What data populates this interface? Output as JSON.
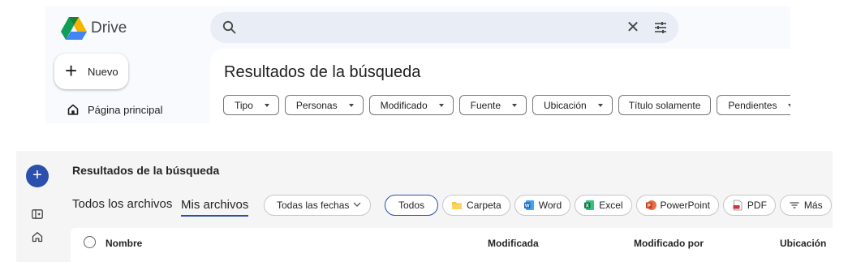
{
  "drive": {
    "app_name": "Drive",
    "search": {
      "placeholder": ""
    },
    "new_button": "Nuevo",
    "home_label": "Página principal",
    "results_title": "Resultados de la búsqueda",
    "filters": [
      {
        "label": "Tipo",
        "dropdown": true
      },
      {
        "label": "Personas",
        "dropdown": true
      },
      {
        "label": "Modificado",
        "dropdown": true
      },
      {
        "label": "Fuente",
        "dropdown": true
      },
      {
        "label": "Ubicación",
        "dropdown": true
      },
      {
        "label": "Título solamente",
        "dropdown": false
      },
      {
        "label": "Pendientes",
        "dropdown": true
      }
    ],
    "colors": {
      "logo_green": "#0f9d58",
      "logo_yellow": "#f4b400",
      "logo_blue": "#4285f4",
      "search_bg": "#e9eef6"
    }
  },
  "onedrive": {
    "fab_label": "+",
    "results_title": "Resultados de la búsqueda",
    "tabs": {
      "all": "Todos los archivos",
      "mine": "Mis archivos",
      "selected": "mine"
    },
    "date_filter": "Todas las fechas",
    "type_filters": [
      {
        "label": "Todos",
        "icon": "none",
        "active": true
      },
      {
        "label": "Carpeta",
        "icon": "folder-icon"
      },
      {
        "label": "Word",
        "icon": "word-icon"
      },
      {
        "label": "Excel",
        "icon": "excel-icon"
      },
      {
        "label": "PowerPoint",
        "icon": "powerpoint-icon"
      },
      {
        "label": "PDF",
        "icon": "pdf-icon"
      },
      {
        "label": "Más",
        "icon": "filter-lines-icon"
      }
    ],
    "columns": {
      "name": "Nombre",
      "modified": "Modificada",
      "modified_by": "Modificado por",
      "location": "Ubicación"
    },
    "colors": {
      "accent": "#2a4fad",
      "word": "#185abd",
      "excel": "#107c41",
      "powerpoint": "#c43e1c",
      "pdf": "#d13438",
      "folder": "#f8c23e"
    }
  }
}
